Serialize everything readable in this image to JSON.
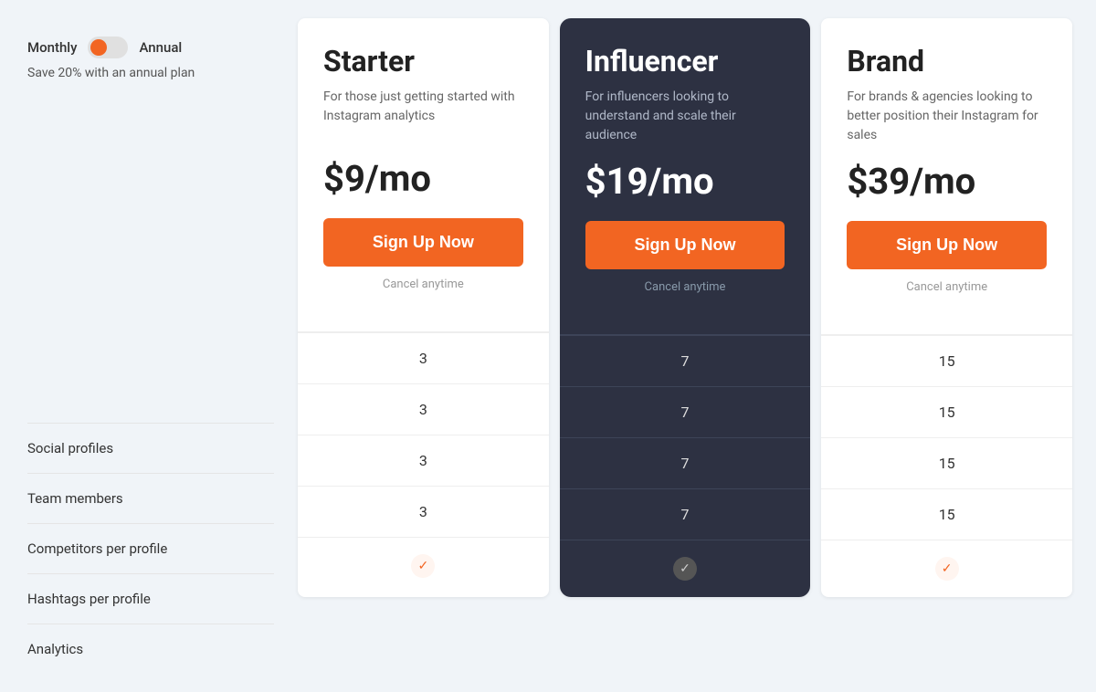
{
  "sidebar": {
    "monthly_label": "Monthly",
    "annual_label": "Annual",
    "save_text": "Save 20% with an annual plan",
    "features": [
      "Social profiles",
      "Team members",
      "Competitors per profile",
      "Hashtags per profile",
      "Analytics"
    ]
  },
  "plans": [
    {
      "id": "starter",
      "name": "Starter",
      "description": "For those just getting started with Instagram analytics",
      "price": "$9/mo",
      "cta": "Sign Up Now",
      "cancel": "Cancel anytime",
      "highlighted": false,
      "values": [
        "3",
        "3",
        "3",
        "3",
        "check_orange"
      ]
    },
    {
      "id": "influencer",
      "name": "Influencer",
      "description": "For influencers looking to understand and scale their audience",
      "price": "$19/mo",
      "cta": "Sign Up Now",
      "cancel": "Cancel anytime",
      "highlighted": true,
      "values": [
        "7",
        "7",
        "7",
        "7",
        "check_gray"
      ]
    },
    {
      "id": "brand",
      "name": "Brand",
      "description": "For brands & agencies looking to better position their Instagram for sales",
      "price": "$39/mo",
      "cta": "Sign Up Now",
      "cancel": "Cancel anytime",
      "highlighted": false,
      "values": [
        "15",
        "15",
        "15",
        "15",
        "check_orange"
      ]
    }
  ],
  "colors": {
    "orange": "#f26522",
    "dark": "#2d3142"
  }
}
